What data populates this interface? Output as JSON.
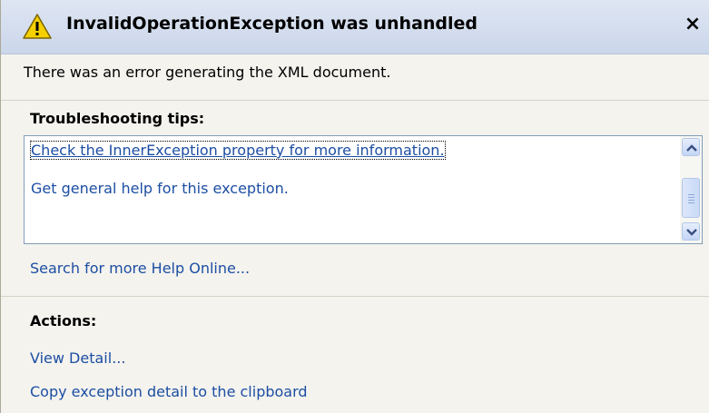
{
  "dialog": {
    "title": "InvalidOperationException was unhandled",
    "close_glyph": "×",
    "message": "There was an error generating the XML document.",
    "icons": {
      "title_icon": "warning-icon",
      "close_icon": "close-icon"
    }
  },
  "troubleshooting": {
    "heading": "Troubleshooting tips:",
    "tips": [
      "Check the InnerException property for more information.",
      "Get general help for this exception."
    ],
    "search_link": "Search for more Help Online..."
  },
  "actions": {
    "heading": "Actions:",
    "items": [
      "View Detail...",
      "Copy exception detail to the clipboard"
    ]
  },
  "colors": {
    "title_bar": "#cad6ea",
    "background": "#f4f3ee",
    "link": "#1c4ea3",
    "warning": "#f4d000"
  }
}
